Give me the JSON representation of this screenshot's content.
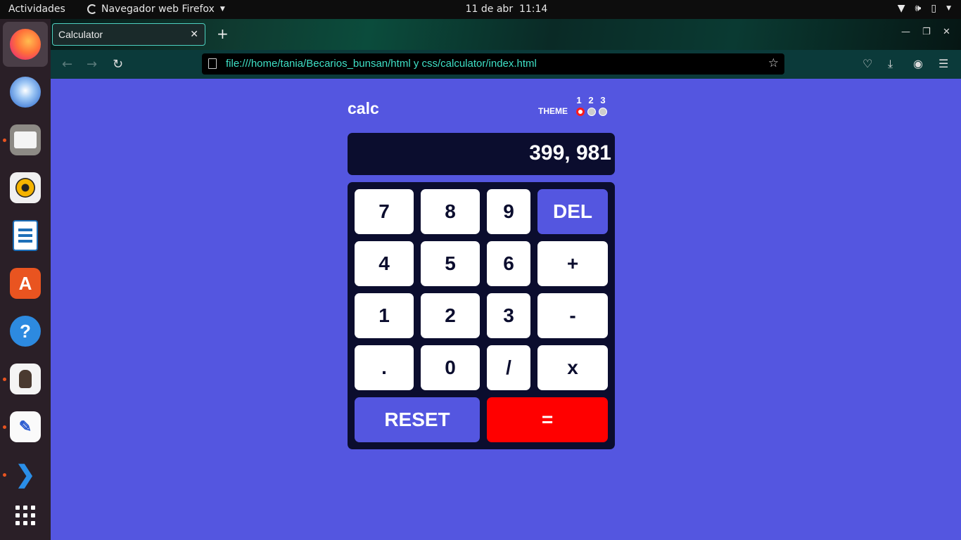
{
  "topbar": {
    "activities": "Actividades",
    "app_name": "Navegador web Firefox",
    "date": "11 de abr",
    "time": "11:14"
  },
  "dock": {
    "items": [
      "firefox-icon",
      "thunderbird-icon",
      "files-icon",
      "rhythmbox-icon",
      "writer-icon",
      "software-icon",
      "help-icon",
      "lingot-icon",
      "text-editor-icon",
      "vscode-icon",
      "show-apps-icon"
    ]
  },
  "browser": {
    "tab_title": "Calculator",
    "url": "file:///home/tania/Becarios_bunsan/html y css/calculator/index.html"
  },
  "calculator": {
    "logo": "calc",
    "theme_label": "THEME",
    "theme_options": [
      "1",
      "2",
      "3"
    ],
    "selected_theme": "1",
    "display": "399, 981",
    "keys": {
      "k7": "7",
      "k8": "8",
      "k9": "9",
      "del": "DEL",
      "k4": "4",
      "k5": "5",
      "k6": "6",
      "plus": "+",
      "k1": "1",
      "k2": "2",
      "k3": "3",
      "minus": "-",
      "dot": ".",
      "k0": "0",
      "divide": "/",
      "multiply": "x",
      "reset": "RESET",
      "equals": "="
    }
  },
  "colors": {
    "page_bg": "#5456e0",
    "keypad_bg": "#0b0d2e",
    "key_bg": "#ffffff",
    "accent_blue": "#5456e0",
    "equals_red": "#ff0000"
  }
}
